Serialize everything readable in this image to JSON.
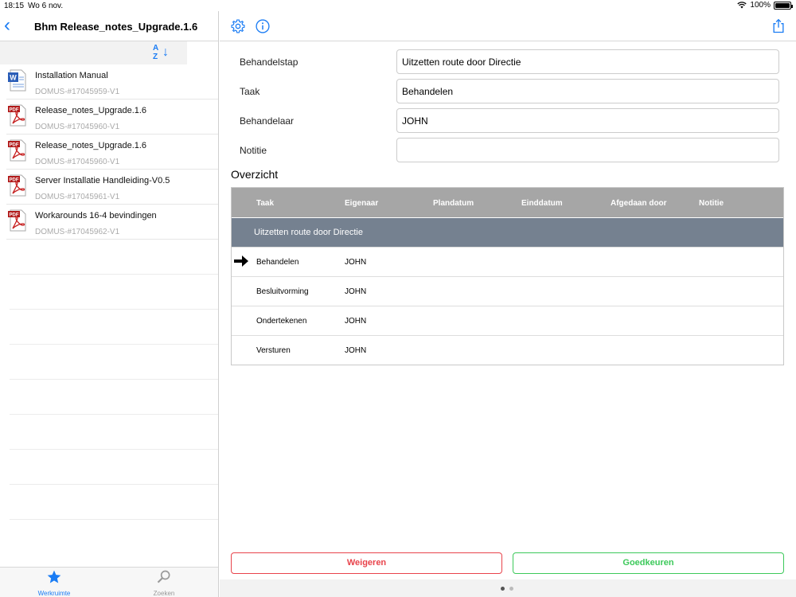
{
  "status_bar": {
    "time": "18:15",
    "date": "Wo 6 nov.",
    "battery": "100%",
    "battery_level": 1.0
  },
  "left_panel": {
    "title": "Bhm Release_notes_Upgrade.1.6",
    "sort_letters": "A\nZ",
    "files": [
      {
        "name": "Installation Manual",
        "id": "DOMUS-#17045959-V1",
        "icon": "word-doc-icon"
      },
      {
        "name": "Release_notes_Upgrade.1.6",
        "id": "DOMUS-#17045960-V1",
        "icon": "pdf-icon"
      },
      {
        "name": "Release_notes_Upgrade.1.6",
        "id": "DOMUS-#17045960-V1",
        "icon": "pdf-icon"
      },
      {
        "name": "Server Installatie Handleiding-V0.5",
        "id": "DOMUS-#17045961-V1",
        "icon": "pdf-icon"
      },
      {
        "name": "Workarounds 16-4 bevindingen",
        "id": "DOMUS-#17045962-V1",
        "icon": "pdf-icon"
      }
    ],
    "pdf_badge": "PDF",
    "tabs": [
      {
        "label": "Werkruimte",
        "icon": "star-icon",
        "active": true
      },
      {
        "label": "Zoeken",
        "icon": "search-icon",
        "active": false
      }
    ]
  },
  "form": {
    "behandelstap": {
      "label": "Behandelstap",
      "value": "Uitzetten route door Directie"
    },
    "taak": {
      "label": "Taak",
      "value": "Behandelen"
    },
    "behandelaar": {
      "label": "Behandelaar",
      "value": "JOHN"
    },
    "notitie": {
      "label": "Notitie",
      "value": ""
    }
  },
  "overview": {
    "title": "Overzicht",
    "columns": [
      "Taak",
      "Eigenaar",
      "Plandatum",
      "Einddatum",
      "Afgedaan door",
      "Notitie"
    ],
    "group": "Uitzetten route door Directie",
    "rows": [
      {
        "taak": "Behandelen",
        "eigenaar": "JOHN",
        "current": true
      },
      {
        "taak": "Besluitvorming",
        "eigenaar": "JOHN",
        "current": false
      },
      {
        "taak": "Ondertekenen",
        "eigenaar": "JOHN",
        "current": false
      },
      {
        "taak": "Versturen",
        "eigenaar": "JOHN",
        "current": false
      }
    ]
  },
  "buttons": {
    "reject": "Weigeren",
    "approve": "Goedkeuren"
  },
  "colors": {
    "accent": "#1a7cf4",
    "reject": "#e8434b",
    "approve": "#3cc95a",
    "group_row": "#758190",
    "header": "#a6a6a6"
  },
  "pager": {
    "pages": 2,
    "current": 1
  }
}
